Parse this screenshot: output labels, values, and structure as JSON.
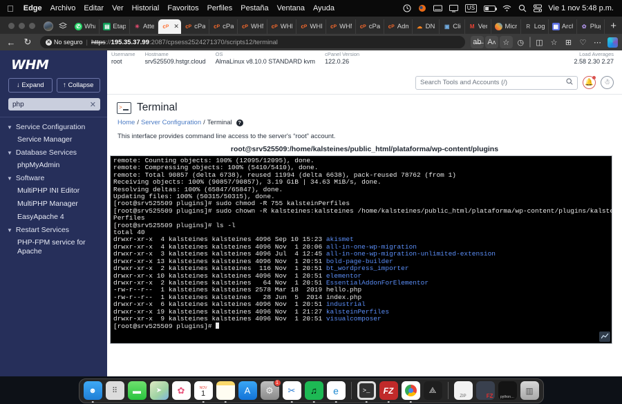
{
  "menubar": {
    "apple_icon": "apple-icon",
    "items": [
      "Edge",
      "Archivo",
      "Editar",
      "Ver",
      "Historial",
      "Favoritos",
      "Perfiles",
      "Pestaña",
      "Ventana",
      "Ayuda"
    ],
    "status_icons": [
      "clock-icon",
      "firefox-icon",
      "keyboard-icon",
      "display-icon",
      "input-source-us",
      "battery-icon",
      "wifi-icon",
      "search-icon",
      "control-center-icon"
    ],
    "input_source": "US",
    "clock": "Vie 1 nov 5:48 p.m."
  },
  "browser": {
    "traffic_lights": [
      "close",
      "minimize",
      "zoom"
    ],
    "tabs": [
      {
        "label": "What",
        "favicon": "whatsapp-icon",
        "color": "#25d366",
        "active": false
      },
      {
        "label": "Etapa",
        "favicon": "sheets-icon",
        "color": "#0f9d58",
        "active": false
      },
      {
        "label": "Atten",
        "favicon": "n8n-icon",
        "color": "#ea4b71",
        "active": false
      },
      {
        "label": "\\",
        "favicon": "cpanel-icon",
        "color": "#ff6c2c",
        "active": true
      },
      {
        "label": "cPan",
        "favicon": "cpanel-icon",
        "color": "#ff6c2c",
        "active": false
      },
      {
        "label": "cPan",
        "favicon": "cpanel-icon",
        "color": "#ff6c2c",
        "active": false
      },
      {
        "label": "WHM",
        "favicon": "cpanel-icon",
        "color": "#ff6c2c",
        "active": false
      },
      {
        "label": "WHM",
        "favicon": "cpanel-icon",
        "color": "#ff6c2c",
        "active": false
      },
      {
        "label": "WHM",
        "favicon": "cpanel-icon",
        "color": "#ff6c2c",
        "active": false
      },
      {
        "label": "WHM",
        "favicon": "cpanel-icon",
        "color": "#ff6c2c",
        "active": false
      },
      {
        "label": "cPan",
        "favicon": "cpanel-icon",
        "color": "#ff6c2c",
        "active": false
      },
      {
        "label": "Admi",
        "favicon": "cpanel-icon",
        "color": "#ff6c2c",
        "active": false
      },
      {
        "label": "DNS",
        "favicon": "cloud-icon",
        "color": "#f6821f",
        "active": false
      },
      {
        "label": "Cliq",
        "favicon": "chat-icon",
        "color": "#4a90d9",
        "active": false
      },
      {
        "label": "Verif",
        "favicon": "gmail-icon",
        "color": "#ea4335",
        "active": false
      },
      {
        "label": "Micro",
        "favicon": "microsoft-icon",
        "color": "#7b61ff",
        "active": false
      },
      {
        "label": "Logs",
        "favicon": "generic-icon",
        "color": "#8a8a8a",
        "active": false
      },
      {
        "label": "Archi",
        "favicon": "archive-icon",
        "color": "#5b6ee1",
        "active": false
      },
      {
        "label": "Plugi",
        "favicon": "plugin-icon",
        "color": "#8f7fd4",
        "active": false
      }
    ],
    "new_tab_label": "+",
    "back_icon": "back-arrow-icon",
    "reload_icon": "reload-icon",
    "security_label": "No seguro",
    "url_scheme": "https",
    "url_scheme_sep": "://",
    "url_host": "195.35.37.99",
    "url_path": ":2087/cpsess2524271370/scripts12/terminal",
    "toolbar_icons": [
      "read-aloud-icon",
      "translate-icon",
      "favorite-star-icon",
      "history-icon",
      "split-screen-icon",
      "collections-icon",
      "browser-essentials-icon",
      "settings-more-icon",
      "copilot-icon"
    ]
  },
  "whm": {
    "logo": "WHM",
    "sidebar": {
      "expand_label": "↓ Expand",
      "collapse_label": "↑ Collapse",
      "search_value": "php",
      "search_clear": "✕",
      "groups": [
        {
          "label": "Service Configuration",
          "items": [
            "Service Manager"
          ]
        },
        {
          "label": "Database Services",
          "items": [
            "phpMyAdmin"
          ]
        },
        {
          "label": "Software",
          "items": [
            "MultiPHP INI Editor",
            "MultiPHP Manager",
            "EasyApache 4"
          ]
        },
        {
          "label": "Restart Services",
          "items": [
            "PHP-FPM service for Apache"
          ]
        }
      ]
    },
    "server_info": {
      "username_label": "Username",
      "username_value": "root",
      "hostname_label": "Hostname",
      "hostname_value": "srv525509.hstgr.cloud",
      "os_label": "OS",
      "os_value": "AlmaLinux v8.10.0 STANDARD kvm",
      "cpanel_label": "cPanel Version",
      "cpanel_value": "122.0.26",
      "load_label": "Load Averages",
      "load_value": "2.58  2.30  2.27"
    },
    "search_placeholder": "Search Tools and Accounts (/)",
    "search_icon": "search-icon",
    "bell_icon": "bell-icon",
    "user_icon": "user-avatar-icon",
    "page_title": "Terminal",
    "page_icon": "terminal-icon",
    "breadcrumb": {
      "home": "Home",
      "sep1": "/",
      "section": "Server Configuration",
      "sep2": "/",
      "current": "Terminal",
      "help_icon": "help-icon",
      "help_glyph": "?"
    },
    "description": "This interface provides command line access to the server's “root” account.",
    "terminal_header": "root@srv525509:/home/kalsteines/public_html/plataforma/wp-content/plugins",
    "terminal_resize_icon": "resize-handle-icon",
    "terminal_lines": [
      {
        "text": "remote: Counting objects: 100% (12095/12095), done."
      },
      {
        "text": "remote: Compressing objects: 100% (5410/5410), done."
      },
      {
        "text": "remote: Total 90857 (delta 6738), reused 11994 (delta 6638), pack-reused 78762 (from 1)"
      },
      {
        "text": "Receiving objects: 100% (90857/90857), 3.19 GiB | 34.63 MiB/s, done."
      },
      {
        "text": "Resolving deltas: 100% (65847/65847), done."
      },
      {
        "text": "Updating files: 100% (50315/50315), done."
      },
      {
        "text": "[root@srv525509 plugins]# sudo chmod -R 755 kalsteinPerfiles"
      },
      {
        "text": "[root@srv525509 plugins]# sudo chown -R kalsteines:kalsteines /home/kalsteines/public_html/plataforma/wp-content/plugins/kalstein"
      },
      {
        "text": "Perfiles"
      },
      {
        "text": "[root@srv525509 plugins]# ls -l"
      },
      {
        "text": "total 40"
      },
      {
        "text": "drwxr-xr-x  4 kalsteines kalsteines 4096 Sep 10 15:23 ",
        "dir": "akismet"
      },
      {
        "text": "drwxr-xr-x  4 kalsteines kalsteines 4096 Nov  1 20:06 ",
        "dir": "all-in-one-wp-migration"
      },
      {
        "text": "drwxr-xr-x  3 kalsteines kalsteines 4096 Jul  4 12:45 ",
        "dir": "all-in-one-wp-migration-unlimited-extension"
      },
      {
        "text": "drwxr-xr-x 13 kalsteines kalsteines 4096 Nov  1 20:51 ",
        "dir": "bold-page-builder"
      },
      {
        "text": "drwxr-xr-x  2 kalsteines kalsteines  116 Nov  1 20:51 ",
        "dir": "bt_wordpress_importer"
      },
      {
        "text": "drwxr-xr-x 10 kalsteines kalsteines 4096 Nov  1 20:51 ",
        "dir": "elementor"
      },
      {
        "text": "drwxr-xr-x  2 kalsteines kalsteines   64 Nov  1 20:51 ",
        "dir": "EssentialAddonForElementor"
      },
      {
        "text": "-rw-r--r--  1 kalsteines kalsteines 2578 Mar 18  2019 hello.php"
      },
      {
        "text": "-rw-r--r--  1 kalsteines kalsteines   28 Jun  5  2014 index.php"
      },
      {
        "text": "drwxr-xr-x  6 kalsteines kalsteines 4096 Nov  1 20:51 ",
        "dir": "industrial"
      },
      {
        "text": "drwxr-xr-x 19 kalsteines kalsteines 4096 Nov  1 21:27 ",
        "dir": "kalsteinPerfiles"
      },
      {
        "text": "drwxr-xr-x  9 kalsteines kalsteines 4096 Nov  1 20:51 ",
        "dir": "visualcomposer"
      },
      {
        "text": "[root@srv525509 plugins]# ",
        "cursor": true
      }
    ]
  },
  "dock": {
    "items": [
      {
        "name": "finder-icon",
        "glyph": "☺",
        "bg": "#2e9bf0",
        "running": true
      },
      {
        "name": "launchpad-icon",
        "glyph": "⠿",
        "bg": "#d8d8d8",
        "running": false
      },
      {
        "name": "messages-icon",
        "glyph": "💬",
        "bg": "#49d858",
        "running": false
      },
      {
        "name": "maps-icon",
        "glyph": "➤",
        "bg": "#8ed17f",
        "running": false
      },
      {
        "name": "photos-icon",
        "glyph": "✿",
        "bg": "#ffffff",
        "running": false
      },
      {
        "name": "calendar-icon",
        "glyph": "1",
        "bg": "#ffffff",
        "running": true
      },
      {
        "name": "notes-icon",
        "glyph": "",
        "bg": "#fdf3c0",
        "running": true
      },
      {
        "name": "app-store-icon",
        "glyph": "A",
        "bg": "#1f8df5",
        "running": false
      },
      {
        "name": "system-settings-icon",
        "glyph": "⚙",
        "bg": "#9a9a9a",
        "badge": "1",
        "running": false
      },
      {
        "name": "vscode-icon",
        "glyph": "✖",
        "bg": "#ffffff",
        "running": true
      },
      {
        "name": "spotify-icon",
        "glyph": "♫",
        "bg": "#1db954",
        "running": true
      },
      {
        "name": "edge-icon",
        "glyph": "e",
        "bg": "#ffffff",
        "running": true
      },
      {
        "name": "separator",
        "glyph": "",
        "bg": "",
        "running": false
      },
      {
        "name": "terminal-icon",
        "glyph": ">_",
        "bg": "#2b2b2b",
        "running": true
      },
      {
        "name": "filezilla-icon",
        "glyph": "FZ",
        "bg": "#bf2a2a",
        "running": true
      },
      {
        "name": "chrome-icon",
        "glyph": "◉",
        "bg": "#ffffff",
        "running": true
      },
      {
        "name": "rocket-icon",
        "glyph": "🚀",
        "bg": "#2a2a2a",
        "running": false
      },
      {
        "name": "separator2",
        "glyph": "",
        "bg": "",
        "running": false
      },
      {
        "name": "zip-file-icon",
        "glyph": "ZIP",
        "bg": "#f0f0f0",
        "running": false
      },
      {
        "name": "filezilla-window-icon",
        "glyph": "",
        "bg": "#3a3a48",
        "running": false
      },
      {
        "name": "python-window-icon",
        "glyph": "python…",
        "bg": "#1a1a1a",
        "running": false
      },
      {
        "name": "trash-icon",
        "glyph": "🗑",
        "bg": "#b8b8b8",
        "running": false
      }
    ]
  }
}
